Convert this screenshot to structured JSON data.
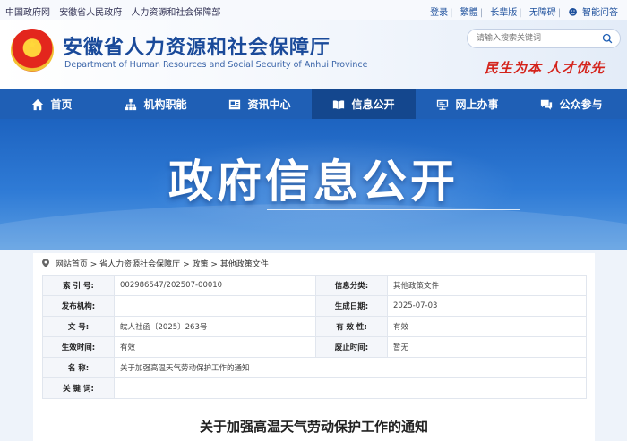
{
  "topbar": {
    "links": [
      "中国政府网",
      "安徽省人民政府",
      "人力资源和社会保障部"
    ],
    "right": [
      "登录",
      "繁體",
      "长辈版",
      "无障碍",
      "智能问答"
    ]
  },
  "header": {
    "title": "安徽省人力资源和社会保障厅",
    "subtitle": "Department of Human Resources and Social Security of Anhui Province",
    "search_placeholder": "请输入搜索关键词",
    "slogan": "民生为本  人才优先"
  },
  "nav": {
    "items": [
      {
        "label": "首页",
        "icon": "home-icon"
      },
      {
        "label": "机构职能",
        "icon": "org-chart-icon"
      },
      {
        "label": "资讯中心",
        "icon": "news-icon"
      },
      {
        "label": "信息公开",
        "icon": "open-book-icon"
      },
      {
        "label": "网上办事",
        "icon": "online-service-icon"
      },
      {
        "label": "公众参与",
        "icon": "chat-icon"
      }
    ],
    "active_index": 3
  },
  "banner": {
    "title": "政府信息公开"
  },
  "breadcrumb": [
    "网站首页",
    "省人力资源社会保障厅",
    "政策",
    "其他政策文件"
  ],
  "info": {
    "index_label": "索 引 号:",
    "index_value": "002986547/202507-00010",
    "category_label": "信息分类:",
    "category_value": "其他政策文件",
    "issuer_label": "发布机构:",
    "issuer_value": "",
    "created_label": "生成日期:",
    "created_value": "2025-07-03",
    "docno_label": "文      号:",
    "docno_value": "皖人社函〔2025〕263号",
    "validity_label": "有 效 性:",
    "validity_value": "有效",
    "effective_label": "生效时间:",
    "effective_value": "有效",
    "repeal_label": "废止时间:",
    "repeal_value": "暂无",
    "name_label": "名      称:",
    "name_value": "关于加强高温天气劳动保护工作的通知",
    "keywords_label": "关 键 词:",
    "keywords_value": ""
  },
  "doc_title": "关于加强高温天气劳动保护工作的通知",
  "colors": {
    "nav": "#1f5fb5",
    "nav_active": "#14478e",
    "brand_blue": "#1a4a9a",
    "slogan_red": "#d4231b"
  }
}
